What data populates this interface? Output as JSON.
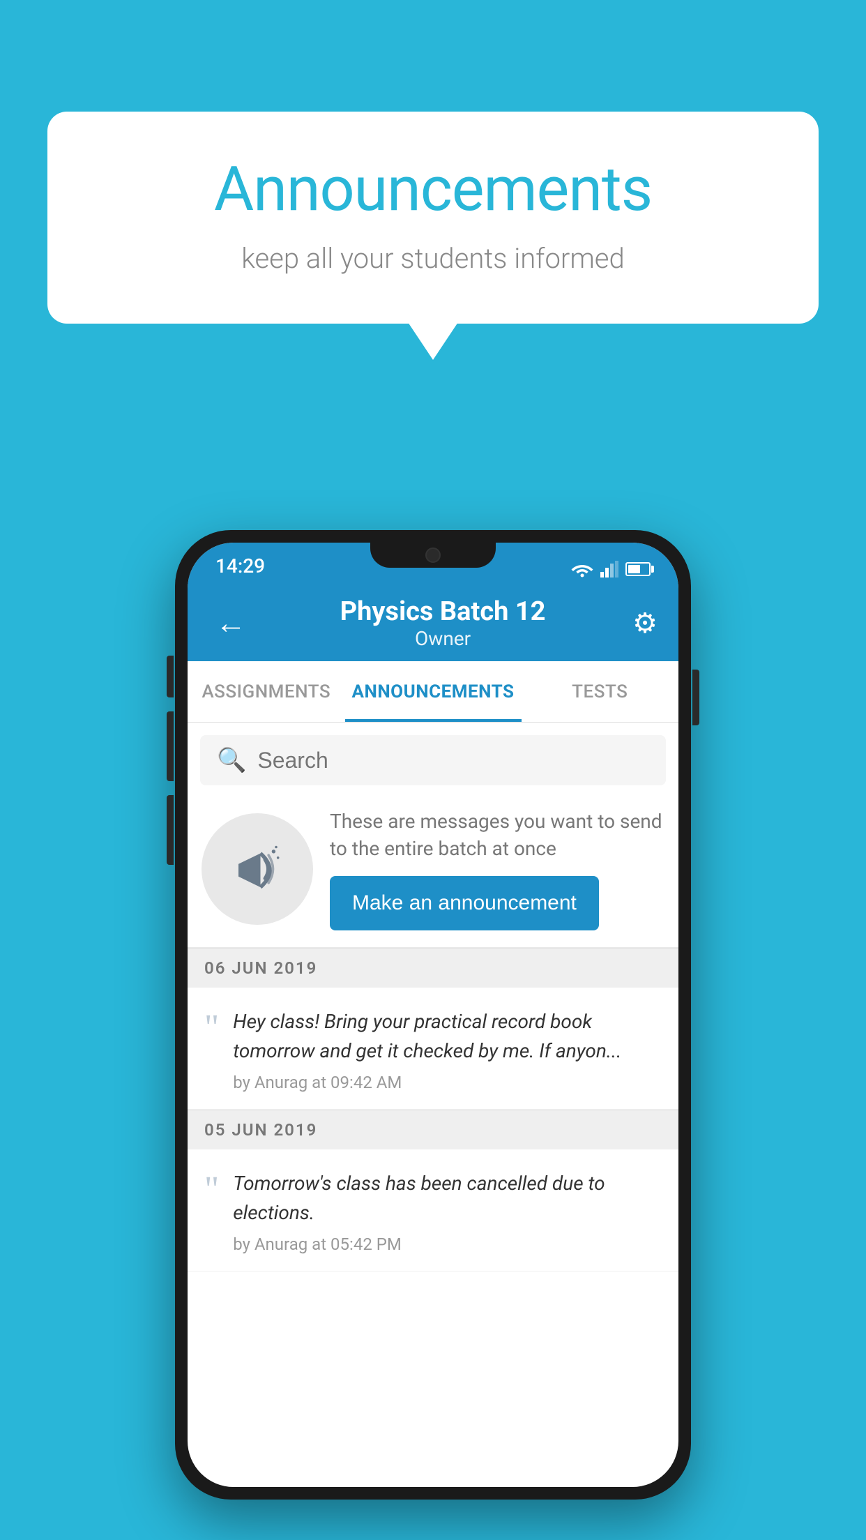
{
  "bubble": {
    "title": "Announcements",
    "subtitle": "keep all your students informed"
  },
  "phone": {
    "status": {
      "time": "14:29"
    },
    "header": {
      "title": "Physics Batch 12",
      "subtitle": "Owner",
      "back_label": "←",
      "gear_label": "⚙"
    },
    "tabs": [
      {
        "label": "ASSIGNMENTS",
        "active": false
      },
      {
        "label": "ANNOUNCEMENTS",
        "active": true
      },
      {
        "label": "TESTS",
        "active": false
      }
    ],
    "search": {
      "placeholder": "Search"
    },
    "cta": {
      "description": "These are messages you want to send to the entire batch at once",
      "button_label": "Make an announcement"
    },
    "announcements": [
      {
        "date": "06  JUN  2019",
        "text": "Hey class! Bring your practical record book tomorrow and get it checked by me. If anyon...",
        "author": "by Anurag at 09:42 AM"
      },
      {
        "date": "05  JUN  2019",
        "text": "Tomorrow's class has been cancelled due to elections.",
        "author": "by Anurag at 05:42 PM"
      }
    ],
    "colors": {
      "header_bg": "#1e8fc7",
      "active_tab": "#1e8fc7",
      "cta_button": "#1e8fc7"
    }
  }
}
